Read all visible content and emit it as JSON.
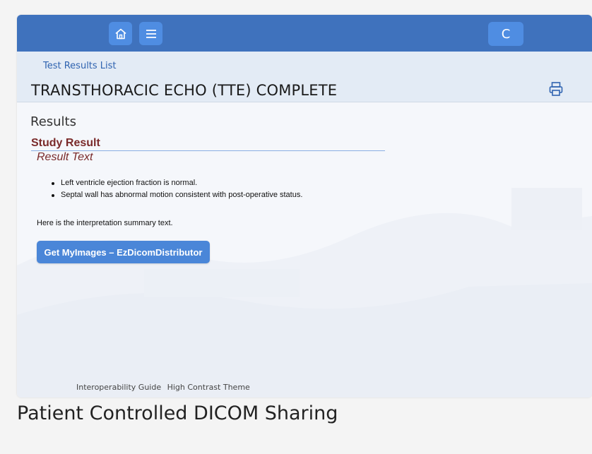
{
  "header": {
    "breadcrumb": "Test Results List",
    "title": "TRANSTHORACIC ECHO (TTE) COMPLETE",
    "print_icon": "printer-icon"
  },
  "topbar": {
    "home_icon": "home-icon",
    "menu_icon": "menu-icon",
    "avatar_initial": "C",
    "color": "#3f72bd",
    "button_color": "#4f8de2"
  },
  "results": {
    "section_title": "Results",
    "study_heading": "Study Result",
    "result_text_label": "Result Text",
    "findings": [
      "Left ventricle ejection fraction is normal.",
      "Septal wall has abnormal motion consistent with post-operative status."
    ],
    "summary": "Here is the interpretation summary text.",
    "button_label": "Get MyImages – EzDicomDistributor",
    "heading_color": "#7a2a2a"
  },
  "footer": {
    "links": [
      "Interoperability Guide",
      "High Contrast Theme"
    ]
  },
  "caption": "Patient Controlled DICOM Sharing"
}
